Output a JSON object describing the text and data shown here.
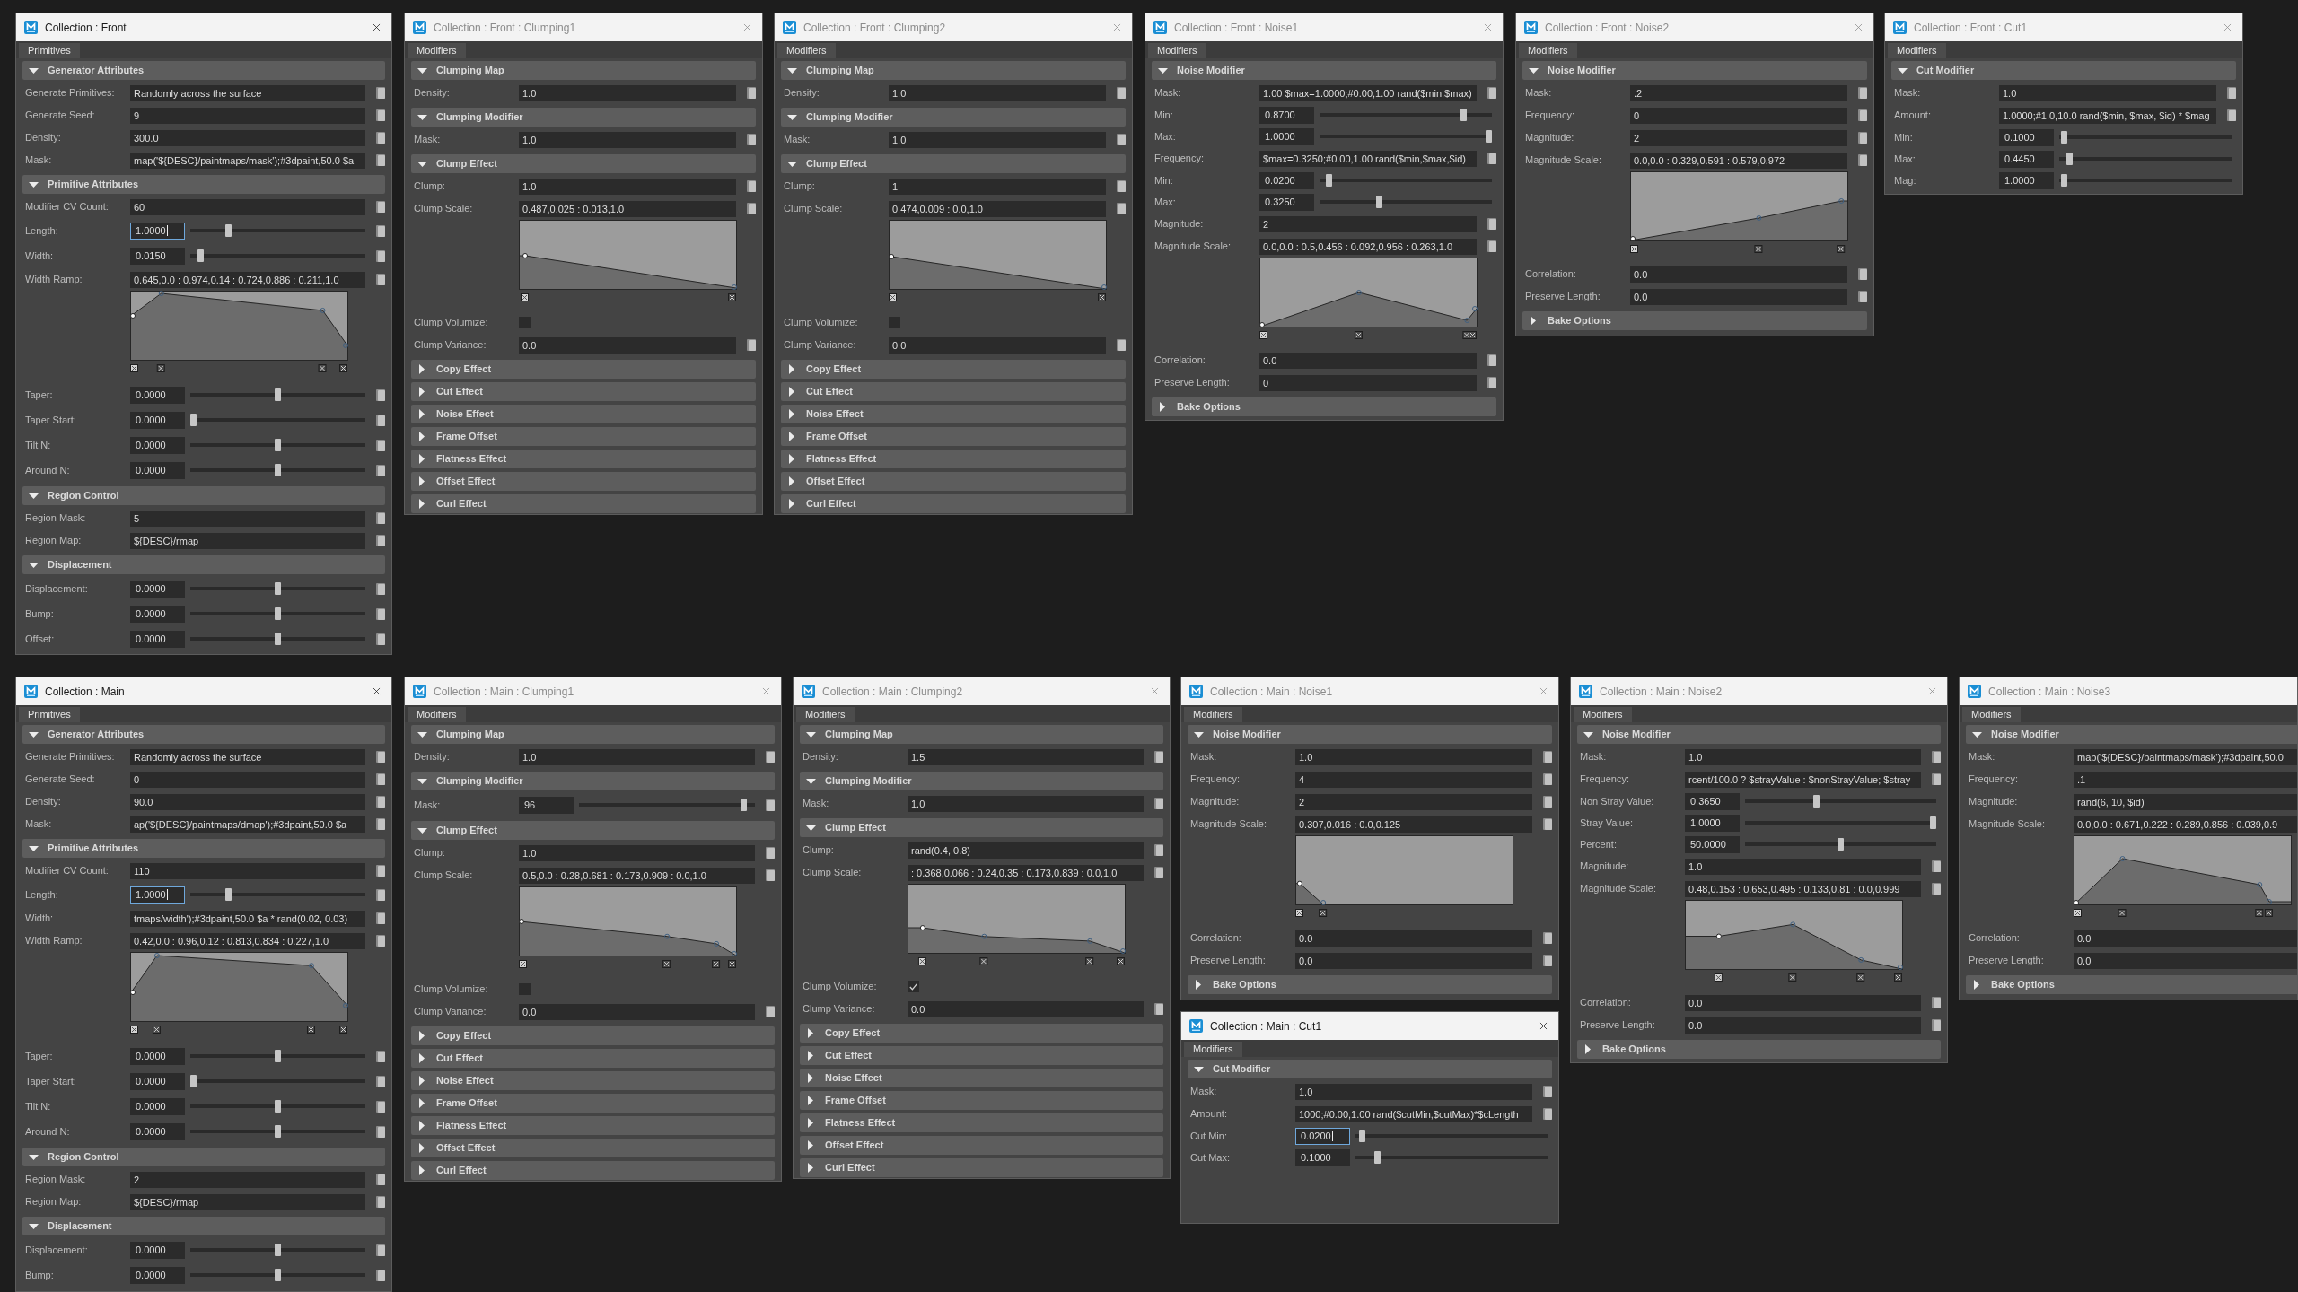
{
  "windows": [
    {
      "title": "Collection : Front",
      "active": true,
      "tabs": [
        {
          "label": "Primitives",
          "selected": true
        }
      ],
      "sections": [
        {
          "title": "Generator Attributes",
          "expanded": true,
          "rows": [
            {
              "kind": "field",
              "label": "Generate Primitives:",
              "value": "Randomly across the surface"
            },
            {
              "kind": "field",
              "label": "Generate Seed:",
              "value": "9"
            },
            {
              "kind": "field",
              "label": "Density:",
              "value": "300.0"
            },
            {
              "kind": "field",
              "label": "Mask:",
              "value": "map('${DESC}/paintmaps/mask');#3dpaint,50.0 $a"
            }
          ]
        },
        {
          "title": "Primitive Attributes",
          "expanded": true,
          "rows": [
            {
              "kind": "field",
              "label": "Modifier CV Count:",
              "value": "60"
            },
            {
              "kind": "slider_field",
              "label": "Length:",
              "value": "1.0000",
              "level": 0.21,
              "focused": true
            },
            {
              "kind": "slider_field",
              "label": "Width:",
              "value": "0.0150",
              "level": 0.04,
              "focused": false
            },
            {
              "kind": "ramp",
              "label": "Width Ramp:",
              "value": "0.645,0.0 : 0.974,0.14 : 0.724,0.886 : 0.211,1.0"
            },
            {
              "kind": "slider_field",
              "label": "Taper:",
              "value": "0.0000",
              "level": 0.5,
              "focused": false
            },
            {
              "kind": "slider_field",
              "label": "Taper Start:",
              "value": "0.0000",
              "level": 0.0,
              "focused": false
            },
            {
              "kind": "slider_field",
              "label": "Tilt N:",
              "value": "0.0000",
              "level": 0.5,
              "focused": false
            },
            {
              "kind": "slider_field",
              "label": "Around N:",
              "value": "0.0000",
              "level": 0.5,
              "focused": false
            }
          ]
        },
        {
          "title": "Region Control",
          "expanded": true,
          "rows": [
            {
              "kind": "field",
              "label": "Region Mask:",
              "value": "5"
            },
            {
              "kind": "field",
              "label": "Region Map:",
              "value": "${DESC}/rmap"
            }
          ]
        },
        {
          "title": "Displacement",
          "expanded": true,
          "rows": [
            {
              "kind": "slider_field",
              "label": "Displacement:",
              "value": "0.0000",
              "level": 0.5,
              "focused": false
            },
            {
              "kind": "slider_field",
              "label": "Bump:",
              "value": "0.0000",
              "level": 0.5,
              "focused": false
            },
            {
              "kind": "slider_field",
              "label": "Offset:",
              "value": "0.0000",
              "level": 0.5,
              "focused": false
            }
          ]
        }
      ]
    },
    {
      "title": "Collection : Front : Clumping1",
      "active": false,
      "tabs": [
        {
          "label": "Modifiers",
          "selected": true
        }
      ],
      "sections": [
        {
          "title": "Clumping Map",
          "expanded": true,
          "rows": [
            {
              "kind": "field",
              "label": "Density:",
              "value": "1.0"
            }
          ]
        },
        {
          "title": "Clumping Modifier",
          "expanded": true,
          "rows": [
            {
              "kind": "field",
              "label": "Mask:",
              "value": "1.0"
            }
          ]
        },
        {
          "title": "Clump Effect",
          "expanded": true,
          "rows": [
            {
              "kind": "field",
              "label": "Clump:",
              "value": "1.0"
            },
            {
              "kind": "ramp",
              "label": "Clump Scale:",
              "value": "0.487,0.025 : 0.013,1.0"
            },
            {
              "kind": "checkbox",
              "label": "Clump Volumize:",
              "checked": false
            },
            {
              "kind": "field",
              "label": "Clump Variance:",
              "value": "0.0"
            }
          ]
        },
        {
          "title": "Copy Effect",
          "expanded": false
        },
        {
          "title": "Cut Effect",
          "expanded": false
        },
        {
          "title": "Noise Effect",
          "expanded": false
        },
        {
          "title": "Frame Offset",
          "expanded": false
        },
        {
          "title": "Flatness Effect",
          "expanded": false
        },
        {
          "title": "Offset Effect",
          "expanded": false
        },
        {
          "title": "Curl Effect",
          "expanded": false
        }
      ]
    },
    {
      "title": "Collection : Front : Clumping2",
      "active": false,
      "tabs": [
        {
          "label": "Modifiers",
          "selected": true
        }
      ],
      "sections": [
        {
          "title": "Clumping Map",
          "expanded": true,
          "rows": [
            {
              "kind": "field",
              "label": "Density:",
              "value": "1.0"
            }
          ]
        },
        {
          "title": "Clumping Modifier",
          "expanded": true,
          "rows": [
            {
              "kind": "field",
              "label": "Mask:",
              "value": "1.0"
            }
          ]
        },
        {
          "title": "Clump Effect",
          "expanded": true,
          "rows": [
            {
              "kind": "field",
              "label": "Clump:",
              "value": "1"
            },
            {
              "kind": "ramp",
              "label": "Clump Scale:",
              "value": "0.474,0.009 : 0.0,1.0"
            },
            {
              "kind": "checkbox",
              "label": "Clump Volumize:",
              "checked": false
            },
            {
              "kind": "field",
              "label": "Clump Variance:",
              "value": "0.0"
            }
          ]
        },
        {
          "title": "Copy Effect",
          "expanded": false
        },
        {
          "title": "Cut Effect",
          "expanded": false
        },
        {
          "title": "Noise Effect",
          "expanded": false
        },
        {
          "title": "Frame Offset",
          "expanded": false
        },
        {
          "title": "Flatness Effect",
          "expanded": false
        },
        {
          "title": "Offset Effect",
          "expanded": false
        },
        {
          "title": "Curl Effect",
          "expanded": false
        }
      ]
    },
    {
      "title": "Collection : Front : Noise1",
      "active": false,
      "tabs": [
        {
          "label": "Modifiers",
          "selected": true
        }
      ],
      "sections": [
        {
          "title": "Noise Modifier",
          "expanded": true,
          "rows": [
            {
              "kind": "field",
              "label": "Mask:",
              "value": "1.00 $max=1.0000;#0.00,1.00 rand($min,$max)"
            },
            {
              "kind": "slider",
              "label": "Min:",
              "value": "0.8700",
              "level": 0.85,
              "focused": false
            },
            {
              "kind": "slider",
              "label": "Max:",
              "value": "1.0000",
              "level": 1.0,
              "focused": false
            },
            {
              "kind": "field",
              "label": "Frequency:",
              "value": "$max=0.3250;#0.00,1.00 rand($min,$max,$id)"
            },
            {
              "kind": "slider",
              "label": "Min:",
              "value": "0.0200",
              "level": 0.04,
              "focused": false
            },
            {
              "kind": "slider",
              "label": "Max:",
              "value": "0.3250",
              "level": 0.34,
              "focused": false
            },
            {
              "kind": "field",
              "label": "Magnitude:",
              "value": "2"
            },
            {
              "kind": "ramp",
              "label": "Magnitude Scale:",
              "value": "0.0,0.0 : 0.5,0.456 : 0.092,0.956 : 0.263,1.0"
            },
            {
              "kind": "field",
              "label": "Correlation:",
              "value": "0.0"
            },
            {
              "kind": "field",
              "label": "Preserve Length:",
              "value": "0"
            }
          ]
        },
        {
          "title": "Bake Options",
          "expanded": false
        }
      ]
    },
    {
      "title": "Collection : Front : Noise2",
      "active": false,
      "tabs": [
        {
          "label": "Modifiers",
          "selected": true
        }
      ],
      "sections": [
        {
          "title": "Noise Modifier",
          "expanded": true,
          "rows": [
            {
              "kind": "field",
              "label": "Mask:",
              "value": ".2"
            },
            {
              "kind": "field",
              "label": "Frequency:",
              "value": "0"
            },
            {
              "kind": "field",
              "label": "Magnitude:",
              "value": "2"
            },
            {
              "kind": "ramp",
              "label": "Magnitude Scale:",
              "value": "0.0,0.0 : 0.329,0.591 : 0.579,0.972"
            },
            {
              "kind": "field",
              "label": "Correlation:",
              "value": "0.0"
            },
            {
              "kind": "field",
              "label": "Preserve Length:",
              "value": "0.0"
            }
          ]
        },
        {
          "title": "Bake Options",
          "expanded": false
        }
      ]
    },
    {
      "title": "Collection : Front : Cut1",
      "active": false,
      "tabs": [
        {
          "label": "Modifiers",
          "selected": true
        }
      ],
      "sections": [
        {
          "title": "Cut Modifier",
          "expanded": true,
          "rows": [
            {
              "kind": "field",
              "label": "Mask:",
              "value": "1.0"
            },
            {
              "kind": "field",
              "label": "Amount:",
              "value": "1.0000;#1.0,10.0 rand($min, $max, $id) * $mag"
            },
            {
              "kind": "slider",
              "label": "Min:",
              "value": "0.1000",
              "level": 0.01,
              "focused": false
            },
            {
              "kind": "slider",
              "label": "Max:",
              "value": "0.4450",
              "level": 0.045,
              "focused": false
            },
            {
              "kind": "slider",
              "label": "Mag:",
              "value": "1.0000",
              "level": 0.01,
              "focused": false
            }
          ]
        }
      ]
    },
    {
      "title": "Collection : Main",
      "active": true,
      "tabs": [
        {
          "label": "Primitives",
          "selected": true
        }
      ],
      "sections": [
        {
          "title": "Generator Attributes",
          "expanded": true,
          "rows": [
            {
              "kind": "field",
              "label": "Generate Primitives:",
              "value": "Randomly across the surface"
            },
            {
              "kind": "field",
              "label": "Generate Seed:",
              "value": "0"
            },
            {
              "kind": "field",
              "label": "Density:",
              "value": "90.0"
            },
            {
              "kind": "field",
              "label": "Mask:",
              "value": "ap('${DESC}/paintmaps/dmap');#3dpaint,50.0 $a"
            }
          ]
        },
        {
          "title": "Primitive Attributes",
          "expanded": true,
          "rows": [
            {
              "kind": "field",
              "label": "Modifier CV Count:",
              "value": "110"
            },
            {
              "kind": "slider_field",
              "label": "Length:",
              "value": "1.0000",
              "level": 0.21,
              "focused": true
            },
            {
              "kind": "field",
              "label": "Width:",
              "value": "tmaps/width');#3dpaint,50.0 $a * rand(0.02, 0.03)"
            },
            {
              "kind": "ramp",
              "label": "Width Ramp:",
              "value": "0.42,0.0 : 0.96,0.12 : 0.813,0.834 : 0.227,1.0"
            },
            {
              "kind": "slider_field",
              "label": "Taper:",
              "value": "0.0000",
              "level": 0.5,
              "focused": false
            },
            {
              "kind": "slider_field",
              "label": "Taper Start:",
              "value": "0.0000",
              "level": 0.0,
              "focused": false
            },
            {
              "kind": "slider_field",
              "label": "Tilt N:",
              "value": "0.0000",
              "level": 0.5,
              "focused": false
            },
            {
              "kind": "slider_field",
              "label": "Around N:",
              "value": "0.0000",
              "level": 0.5,
              "focused": false
            }
          ]
        },
        {
          "title": "Region Control",
          "expanded": true,
          "rows": [
            {
              "kind": "field",
              "label": "Region Mask:",
              "value": "2"
            },
            {
              "kind": "field",
              "label": "Region Map:",
              "value": "${DESC}/rmap"
            }
          ]
        },
        {
          "title": "Displacement",
          "expanded": true,
          "rows": [
            {
              "kind": "slider_field",
              "label": "Displacement:",
              "value": "0.0000",
              "level": 0.5,
              "focused": false
            },
            {
              "kind": "slider_field",
              "label": "Bump:",
              "value": "0.0000",
              "level": 0.5,
              "focused": false
            }
          ]
        }
      ]
    },
    {
      "title": "Collection : Main : Clumping1",
      "active": false,
      "tabs": [
        {
          "label": "Modifiers",
          "selected": true
        }
      ],
      "sections": [
        {
          "title": "Clumping Map",
          "expanded": true,
          "rows": [
            {
              "kind": "field",
              "label": "Density:",
              "value": "1.0"
            }
          ]
        },
        {
          "title": "Clumping Modifier",
          "expanded": true,
          "rows": [
            {
              "kind": "slider_field",
              "label": "Mask:",
              "value": "96",
              "level": 0.95,
              "focused": false
            }
          ]
        },
        {
          "title": "Clump Effect",
          "expanded": true,
          "rows": [
            {
              "kind": "field",
              "label": "Clump:",
              "value": "1.0"
            },
            {
              "kind": "ramp",
              "label": "Clump Scale:",
              "value": "0.5,0.0 : 0.28,0.681 : 0.173,0.909 : 0.0,1.0"
            },
            {
              "kind": "checkbox",
              "label": "Clump Volumize:",
              "checked": false
            },
            {
              "kind": "field",
              "label": "Clump Variance:",
              "value": "0.0"
            }
          ]
        },
        {
          "title": "Copy Effect",
          "expanded": false
        },
        {
          "title": "Cut Effect",
          "expanded": false
        },
        {
          "title": "Noise Effect",
          "expanded": false
        },
        {
          "title": "Frame Offset",
          "expanded": false
        },
        {
          "title": "Flatness Effect",
          "expanded": false
        },
        {
          "title": "Offset Effect",
          "expanded": false
        },
        {
          "title": "Curl Effect",
          "expanded": false
        }
      ]
    },
    {
      "title": "Collection : Main : Clumping2",
      "active": false,
      "tabs": [
        {
          "label": "Modifiers",
          "selected": true
        }
      ],
      "sections": [
        {
          "title": "Clumping Map",
          "expanded": true,
          "rows": [
            {
              "kind": "field",
              "label": "Density:",
              "value": "1.5"
            }
          ]
        },
        {
          "title": "Clumping Modifier",
          "expanded": true,
          "rows": [
            {
              "kind": "field",
              "label": "Mask:",
              "value": "1.0"
            }
          ]
        },
        {
          "title": "Clump Effect",
          "expanded": true,
          "rows": [
            {
              "kind": "field",
              "label": "Clump:",
              "value": "rand(0.4, 0.8)"
            },
            {
              "kind": "ramp",
              "label": "Clump Scale:",
              "value": ": 0.368,0.066 : 0.24,0.35 : 0.173,0.839 : 0.0,1.0"
            },
            {
              "kind": "checkbox",
              "label": "Clump Volumize:",
              "checked": true
            },
            {
              "kind": "field",
              "label": "Clump Variance:",
              "value": "0.0"
            }
          ]
        },
        {
          "title": "Copy Effect",
          "expanded": false
        },
        {
          "title": "Cut Effect",
          "expanded": false
        },
        {
          "title": "Noise Effect",
          "expanded": false
        },
        {
          "title": "Frame Offset",
          "expanded": false
        },
        {
          "title": "Flatness Effect",
          "expanded": false
        },
        {
          "title": "Offset Effect",
          "expanded": false
        },
        {
          "title": "Curl Effect",
          "expanded": false
        }
      ]
    },
    {
      "title": "Collection : Main : Noise1",
      "active": false,
      "tabs": [
        {
          "label": "Modifiers",
          "selected": true
        }
      ],
      "sections": [
        {
          "title": "Noise Modifier",
          "expanded": true,
          "rows": [
            {
              "kind": "field",
              "label": "Mask:",
              "value": "1.0"
            },
            {
              "kind": "field",
              "label": "Frequency:",
              "value": "4"
            },
            {
              "kind": "field",
              "label": "Magnitude:",
              "value": "2"
            },
            {
              "kind": "ramp",
              "label": "Magnitude Scale:",
              "value": "0.307,0.016 : 0.0,0.125"
            },
            {
              "kind": "field",
              "label": "Correlation:",
              "value": "0.0"
            },
            {
              "kind": "field",
              "label": "Preserve Length:",
              "value": "0.0"
            }
          ]
        },
        {
          "title": "Bake Options",
          "expanded": false
        }
      ]
    },
    {
      "title": "Collection : Main : Cut1",
      "active": true,
      "tabs": [
        {
          "label": "Modifiers",
          "selected": true
        }
      ],
      "sections": [
        {
          "title": "Cut Modifier",
          "expanded": true,
          "rows": [
            {
              "kind": "field",
              "label": "Mask:",
              "value": "1.0"
            },
            {
              "kind": "field",
              "label": "Amount:",
              "value": "1000;#0.00,1.00 rand($cutMin,$cutMax)*$cLength"
            },
            {
              "kind": "slider",
              "label": "Cut Min:",
              "value": "0.0200",
              "level": 0.02,
              "focused": true
            },
            {
              "kind": "slider",
              "label": "Cut Max:",
              "value": "0.1000",
              "level": 0.1,
              "focused": false
            }
          ]
        }
      ]
    },
    {
      "title": "Collection : Main : Noise2",
      "active": false,
      "tabs": [
        {
          "label": "Modifiers",
          "selected": true
        }
      ],
      "sections": [
        {
          "title": "Noise Modifier",
          "expanded": true,
          "rows": [
            {
              "kind": "field",
              "label": "Mask:",
              "value": "1.0"
            },
            {
              "kind": "field",
              "label": "Frequency:",
              "value": "rcent/100.0 ? $strayValue : $nonStrayValue; $stray"
            },
            {
              "kind": "slider",
              "label": "Non Stray Value:",
              "value": "0.3650",
              "level": 0.37,
              "focused": false
            },
            {
              "kind": "slider",
              "label": "Stray Value:",
              "value": "1.0000",
              "level": 1.0,
              "focused": false
            },
            {
              "kind": "slider",
              "label": "Percent:",
              "value": "50.0000",
              "level": 0.5,
              "focused": false
            },
            {
              "kind": "field",
              "label": "Magnitude:",
              "value": "1.0"
            },
            {
              "kind": "ramp",
              "label": "Magnitude Scale:",
              "value": "0.48,0.153 : 0.653,0.495 : 0.133,0.81 : 0.0,0.999"
            },
            {
              "kind": "field",
              "label": "Correlation:",
              "value": "0.0"
            },
            {
              "kind": "field",
              "label": "Preserve Length:",
              "value": "0.0"
            }
          ]
        },
        {
          "title": "Bake Options",
          "expanded": false
        }
      ]
    },
    {
      "title": "Collection : Main : Noise3",
      "active": false,
      "tabs": [
        {
          "label": "Modifiers",
          "selected": true
        }
      ],
      "sections": [
        {
          "title": "Noise Modifier",
          "expanded": true,
          "rows": [
            {
              "kind": "field",
              "label": "Mask:",
              "value": "map('${DESC}/paintmaps/mask');#3dpaint,50.0"
            },
            {
              "kind": "field",
              "label": "Frequency:",
              "value": ".1"
            },
            {
              "kind": "field",
              "label": "Magnitude:",
              "value": "rand(6, 10, $id)"
            },
            {
              "kind": "ramp",
              "label": "Magnitude Scale:",
              "value": "0.0,0.0 : 0.671,0.222 : 0.289,0.856 : 0.039,0.9"
            },
            {
              "kind": "field",
              "label": "Correlation:",
              "value": "0.0"
            },
            {
              "kind": "field",
              "label": "Preserve Length:",
              "value": "0.0"
            }
          ]
        },
        {
          "title": "Bake Options",
          "expanded": false
        }
      ]
    }
  ]
}
